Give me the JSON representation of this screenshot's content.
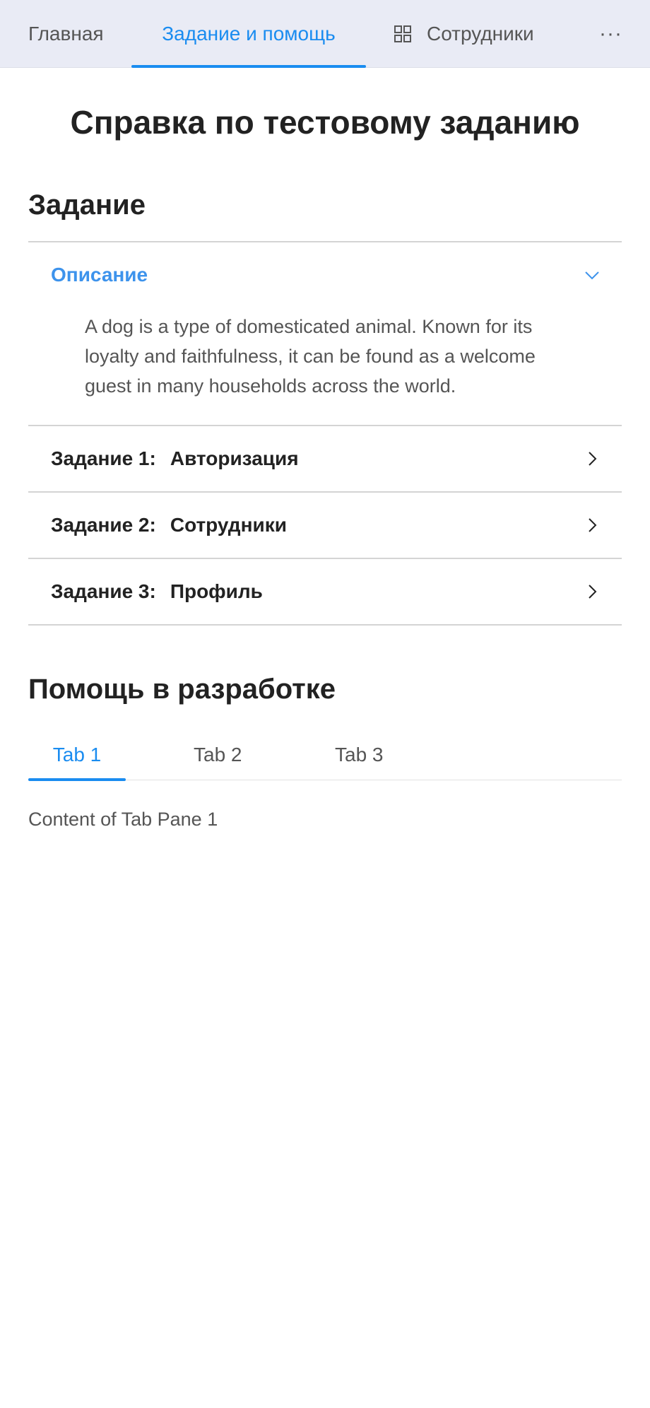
{
  "nav": {
    "home_label": "Главная",
    "task_label": "Задание и помощь",
    "staff_label": "Сотрудники",
    "staff_icon": "grid-icon",
    "more_label": "···",
    "active_color": "#1a8cf0",
    "background": "#e9ebf5"
  },
  "page": {
    "title": "Справка по тестовому заданию"
  },
  "tasks_section": {
    "title": "Задание",
    "items": [
      {
        "prefix": "",
        "label": "Описание",
        "open": true,
        "body": "A dog is a type of domesticated animal. Known for its loyalty and faithfulness, it can be found as a welcome guest in many households across the world."
      },
      {
        "prefix": "Задание 1:",
        "label": "Авторизация",
        "open": false
      },
      {
        "prefix": "Задание 2:",
        "label": "Сотрудники",
        "open": false
      },
      {
        "prefix": "Задание 3:",
        "label": "Профиль",
        "open": false
      }
    ]
  },
  "help_section": {
    "title": "Помощь в разработке",
    "tabs": [
      {
        "label": "Tab 1",
        "active": true
      },
      {
        "label": "Tab 2",
        "active": false
      },
      {
        "label": "Tab 3",
        "active": false
      }
    ],
    "content": "Content of Tab Pane 1"
  }
}
